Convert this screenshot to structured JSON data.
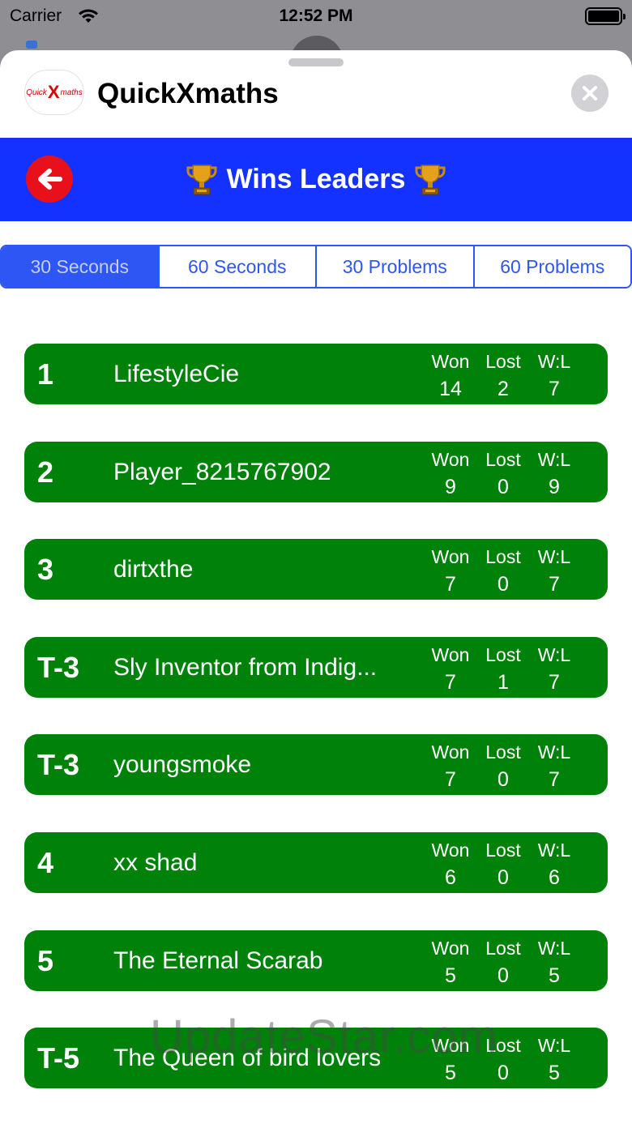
{
  "status_bar": {
    "carrier": "Carrier",
    "time": "12:52 PM"
  },
  "header": {
    "title": "QuickXmaths",
    "logo_small": "Quick",
    "logo_x": "X",
    "logo_rest": "maths"
  },
  "banner": {
    "title": "Wins Leaders"
  },
  "tabs": [
    {
      "label": "30 Seconds",
      "selected": true
    },
    {
      "label": "60 Seconds",
      "selected": false
    },
    {
      "label": "30 Problems",
      "selected": false
    },
    {
      "label": "60 Problems",
      "selected": false
    }
  ],
  "stat_headers": {
    "won": "Won",
    "lost": "Lost",
    "wl": "W:L"
  },
  "leaders": [
    {
      "rank": "1",
      "name": "LifestyleCie",
      "won": "14",
      "lost": "2",
      "wl": "7"
    },
    {
      "rank": "2",
      "name": "Player_8215767902",
      "won": "9",
      "lost": "0",
      "wl": "9"
    },
    {
      "rank": "3",
      "name": "dirtxthe",
      "won": "7",
      "lost": "0",
      "wl": "7"
    },
    {
      "rank": "T-3",
      "name": "Sly Inventor from Indig...",
      "won": "7",
      "lost": "1",
      "wl": "7"
    },
    {
      "rank": "T-3",
      "name": "youngsmoke",
      "won": "7",
      "lost": "0",
      "wl": "7"
    },
    {
      "rank": "4",
      "name": "xx shad",
      "won": "6",
      "lost": "0",
      "wl": "6"
    },
    {
      "rank": "5",
      "name": "The Eternal Scarab",
      "won": "5",
      "lost": "0",
      "wl": "5"
    },
    {
      "rank": "T-5",
      "name": "The Queen of bird lovers",
      "won": "5",
      "lost": "0",
      "wl": "5"
    }
  ],
  "watermark": "UpdateStar.com",
  "colors": {
    "banner": "#1432ff",
    "row": "#00810a",
    "tab_accent": "#2d56f5",
    "back_button": "#e8111b"
  },
  "icons": {
    "close": "close-icon",
    "back": "back-arrow-icon",
    "trophy": "trophy-icon",
    "wifi": "wifi-icon",
    "battery": "battery-icon"
  }
}
